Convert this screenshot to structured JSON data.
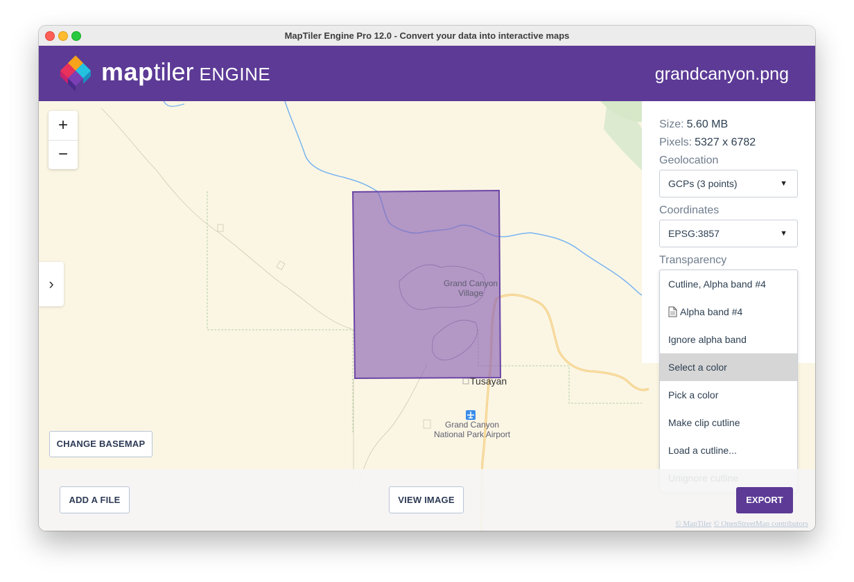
{
  "window": {
    "title": "MapTiler Engine Pro 12.0 - Convert your data into interactive maps"
  },
  "header": {
    "logo": {
      "text_map": "map",
      "text_tiler": "tiler",
      "text_engine": "ENGINE"
    },
    "filename": "grandcanyon.png",
    "color": "#5c3a96"
  },
  "map": {
    "zoom_in_label": "+",
    "zoom_out_label": "−",
    "sidebar_toggle_label": "›",
    "places": {
      "village_line1": "Grand Canyon",
      "village_line2": "Village",
      "tusayan": "Tusayan",
      "airport_line1": "Grand Canyon",
      "airport_line2": "National Park Airport"
    },
    "overlay_color": "#8c64b4",
    "river_color": "#78b4f0",
    "road_color": "#f0c878"
  },
  "panel": {
    "size": {
      "label": "Size:",
      "value": "5.60 MB"
    },
    "pixels": {
      "label": "Pixels:",
      "value": "5327 x 6782"
    },
    "geolocation": {
      "label": "Geolocation",
      "selected": "GCPs (3 points)"
    },
    "coordinates": {
      "label": "Coordinates",
      "selected": "EPSG:3857"
    },
    "transparency": {
      "label": "Transparency",
      "options": [
        "Cutline, Alpha band #4",
        "Alpha band #4",
        "Ignore alpha band",
        "Select a color",
        "Pick a color",
        "Make clip cutline",
        "Load a cutline...",
        "Unignore cutline"
      ],
      "highlighted": "Select a color"
    }
  },
  "buttons": {
    "change_basemap": "CHANGE BASEMAP",
    "add_file": "ADD A FILE",
    "view_image": "VIEW IMAGE",
    "export": "EXPORT"
  },
  "attribution": {
    "maptiler": "© MapTiler",
    "osm": "© OpenStreetMap contributors"
  }
}
